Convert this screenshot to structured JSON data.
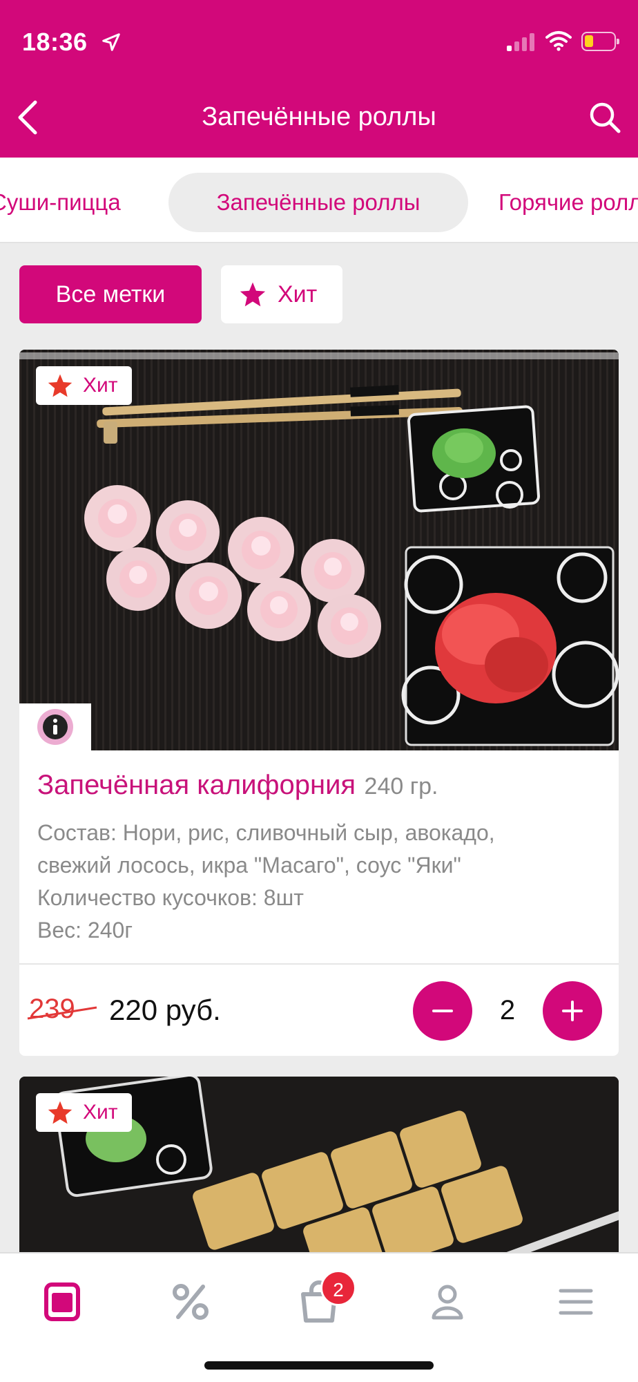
{
  "status_bar": {
    "time": "18:36"
  },
  "header": {
    "title": "Запечённые роллы"
  },
  "category_tabs": [
    {
      "label": "Суши-пицца"
    },
    {
      "label": "Запечённые роллы",
      "active": true
    },
    {
      "label": "Горячие роллы"
    }
  ],
  "tags": {
    "all_label": "Все метки",
    "hit_label": "Хит"
  },
  "product": {
    "badge": "Хит",
    "name": "Запечённая калифорния",
    "weight": "240 гр.",
    "description": [
      "Состав: Нори, рис, сливочный сыр, авокадо,",
      "свежий лосось, икра \"Масаго\", соус \"Яки\"",
      "Количество кусочков: 8шт",
      "Вес: 240г"
    ],
    "old_price": "239",
    "price": "220 руб.",
    "quantity": "2"
  },
  "product2": {
    "badge": "Хит"
  },
  "bottom_nav": {
    "items": [
      "menu-icon",
      "percent-icon",
      "cart-icon",
      "profile-icon",
      "hamburger-icon"
    ],
    "cart_count": "2"
  },
  "colors": {
    "accent": "#d2087a",
    "badge_red": "#e8263a",
    "star": "#e83a2a"
  }
}
